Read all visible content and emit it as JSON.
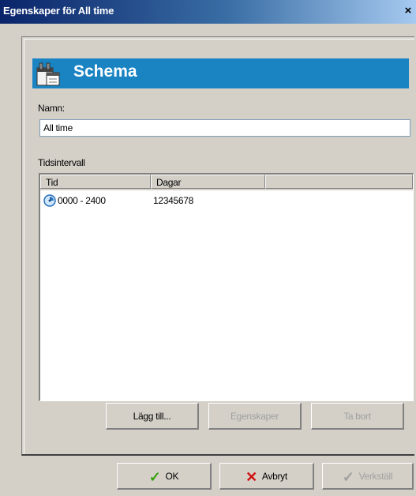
{
  "window": {
    "title": "Egenskaper för All time",
    "close_glyph": "×"
  },
  "header": {
    "title": "Schema",
    "icon": "schedule-icon"
  },
  "name_field": {
    "label": "Namn:",
    "value": "All time"
  },
  "interval": {
    "label": "Tidsintervall",
    "columns": [
      "Tid",
      "Dagar"
    ],
    "rows": [
      {
        "icon": "clock-icon",
        "tid": "0000 - 2400",
        "dagar": "12345678"
      }
    ]
  },
  "list_buttons": {
    "add": "Lägg till...",
    "properties": "Egenskaper",
    "remove": "Ta bort"
  },
  "footer": {
    "ok": "OK",
    "cancel": "Avbryt",
    "apply": "Verkställ"
  },
  "colors": {
    "header_band": "#1a84c3",
    "titlebar_start": "#0a246a",
    "face": "#d4d0c8"
  }
}
